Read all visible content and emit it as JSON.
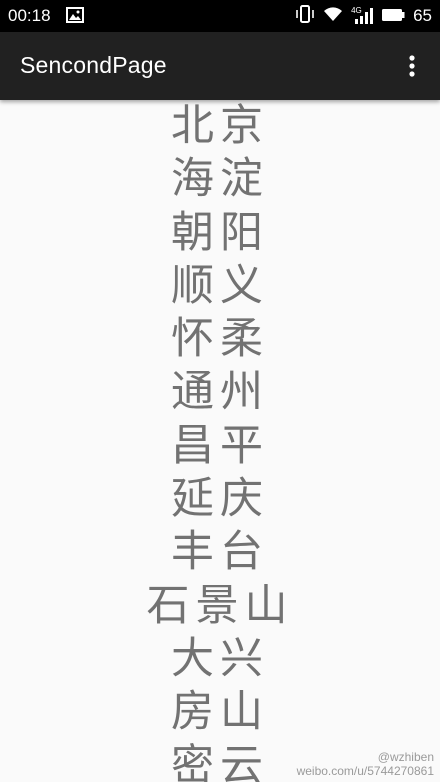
{
  "status_bar": {
    "time": "00:18",
    "network": "4G",
    "battery": "65"
  },
  "app_bar": {
    "title": "SencondPage"
  },
  "districts": [
    "北京",
    "海淀",
    "朝阳",
    "顺义",
    "怀柔",
    "通州",
    "昌平",
    "延庆",
    "丰台",
    "石景山",
    "大兴",
    "房山",
    "密云"
  ],
  "watermark": {
    "handle": "@wzhiben",
    "url": "weibo.com/u/5744270861"
  },
  "colors": {
    "status_bar": "#000000",
    "app_bar": "#212121",
    "background": "#fafafa",
    "item_text": "#727272"
  }
}
